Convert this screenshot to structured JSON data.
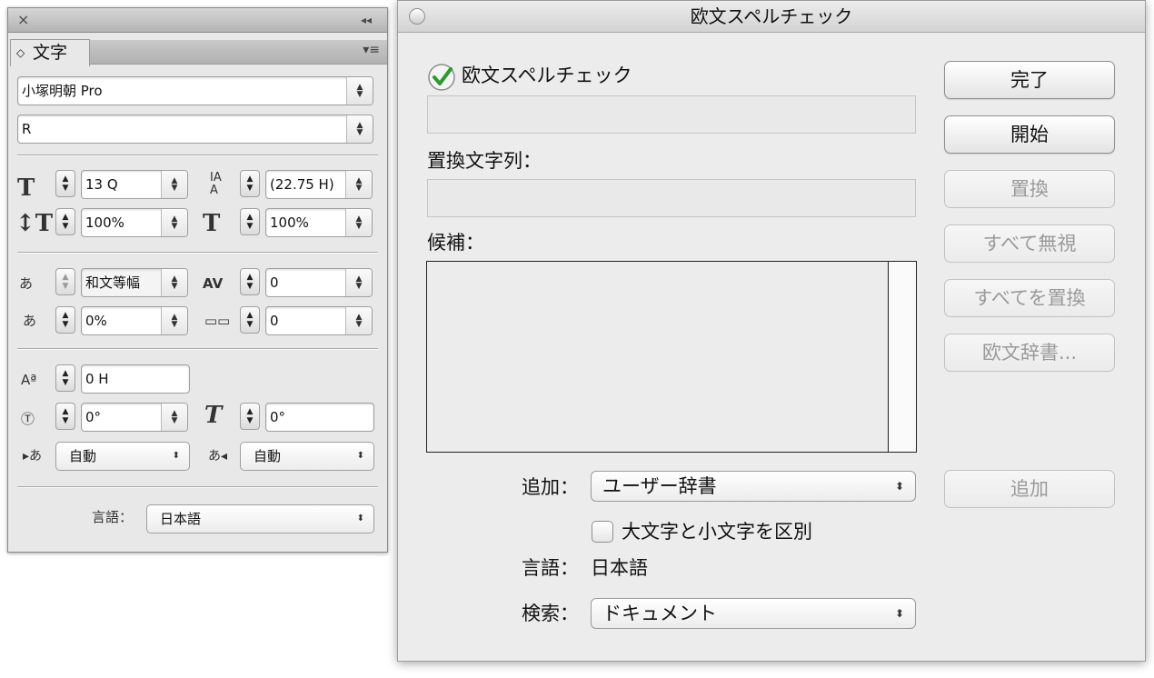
{
  "panel": {
    "tab_label": "文字",
    "close_glyph": "×",
    "collapse_glyph": "◂◂",
    "menu_glyph": "▾≡",
    "tab_toggle_glyph": "◇",
    "font_family": "小塚明朝 Pro",
    "font_style": "R",
    "font_size": "13 Q",
    "leading": "(22.75 H)",
    "vertical_scale": "100%",
    "horizontal_scale": "100%",
    "mojikumi": "和文等幅",
    "tracking": "0",
    "tsume": "0%",
    "kerning_grid": "0",
    "baseline_shift": "0 H",
    "character_rotation": "0°",
    "skew": "0°",
    "aki_before": "自動",
    "aki_after": "自動",
    "language_label": "言語：",
    "language_value": "日本語"
  },
  "dialog": {
    "title": "欧文スペルチェック",
    "status_text": "欧文スペルチェック",
    "replace_label": "置換文字列：",
    "suggestions_label": "候補：",
    "add_label": "追加：",
    "add_to_value": "ユーザー辞書",
    "case_sensitive_label": "大文字と小文字を区別",
    "language_label": "言語：",
    "language_value": "日本語",
    "search_label": "検索：",
    "search_value": "ドキュメント",
    "buttons": {
      "done": "完了",
      "start": "開始",
      "replace": "置換",
      "ignore_all": "すべて無視",
      "replace_all": "すべてを置換",
      "dictionary": "欧文辞書...",
      "add": "追加"
    }
  }
}
